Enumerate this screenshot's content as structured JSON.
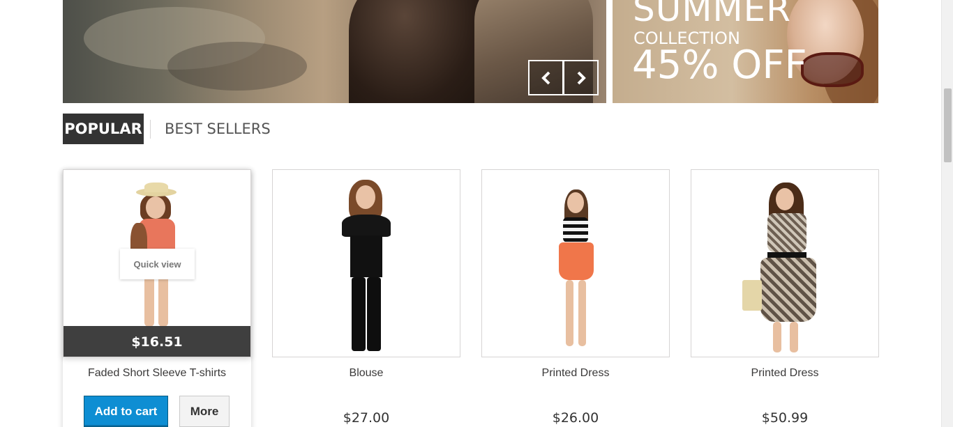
{
  "hero": {
    "prev_icon": "chevron-left-icon",
    "next_icon": "chevron-right-icon"
  },
  "side_banner": {
    "line1": "SUMMER",
    "line2": "COLLECTION",
    "line3": "45% OFF"
  },
  "tabs": [
    {
      "label": "POPULAR",
      "active": true
    },
    {
      "label": "BEST SELLERS",
      "active": false
    }
  ],
  "products": [
    {
      "name": "Faded Short Sleeve T-shirts",
      "price": "$16.51",
      "quick_view": "Quick view",
      "add_to_cart": "Add to cart",
      "more": "More"
    },
    {
      "name": "Blouse",
      "price": "$27.00"
    },
    {
      "name": "Printed Dress",
      "price": "$26.00"
    },
    {
      "name": "Printed Dress",
      "price": "$50.99"
    }
  ],
  "colors": {
    "accent_blue": "#0e8ed3",
    "dark": "#333333",
    "price_bar": "#3f3f3f"
  }
}
